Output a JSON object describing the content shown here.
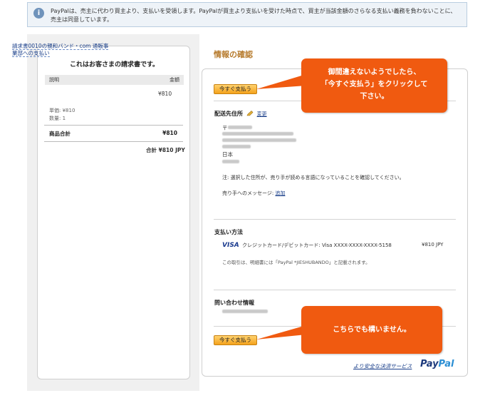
{
  "notice": {
    "text": "PayPalは、売主に代わり買主より、支払いを受領します。PayPalが買主より支払いを受けた時点で、買主が当該金額のさらなる支払い義務を負わないことに、売主は同意しています。"
  },
  "invoice": {
    "title": "これはお客さまの請求書です。",
    "col_desc": "説明",
    "col_amount": "金額",
    "item": {
      "name": "請求書0010の親和バンド・com 通販事業部への支払い",
      "price": "¥810",
      "unit_price": "単価: ¥810",
      "quantity": "数量: 1"
    },
    "subtotal_label": "商品合計",
    "subtotal_value": "¥810",
    "grand_total": "合計 ¥810 JPY"
  },
  "confirm": {
    "heading": "情報の確認",
    "pay_button": "今すぐ支払う",
    "shipping": {
      "title": "配送先住所",
      "change_link": "変更",
      "address_postal": "〒",
      "country": "日本",
      "note": "注: 選択した住所が、売り手が読める言語になっていることを確認してください。",
      "message_label": "売り手へのメッセージ:",
      "message_link": "追加"
    },
    "payment": {
      "title": "支払い方法",
      "card_brand": "VISA",
      "card_desc": "クレジットカード/デビットカード: Visa XXXX-XXXX-XXXX-5158",
      "amount": "¥810 JPY",
      "statement_note": "この取引は、明細書には「PayPal *JIESHUBANDO」と記載されます。"
    },
    "contact": {
      "title": "問い合わせ情報"
    }
  },
  "callouts": {
    "top": "御間違えないようでしたら、\n「今すぐ支払う」をクリックして\n下さい。",
    "bottom": "こちらでも構いません。"
  },
  "footer": {
    "secure_link": "より安全な決済サービス",
    "logo_pay": "Pay",
    "logo_pal": "Pal"
  },
  "colors": {
    "accent_orange": "#f05a10",
    "button_yellow": "#f4a21c",
    "link_blue": "#1a3f8a",
    "heading_gold": "#b67a2b"
  }
}
